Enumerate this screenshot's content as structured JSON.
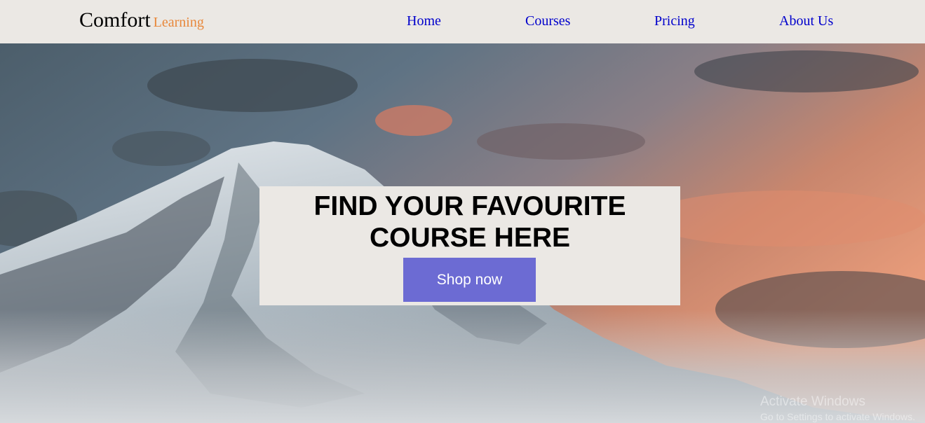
{
  "brand": {
    "main": "Comfort",
    "sub": "Learning"
  },
  "nav": {
    "items": [
      {
        "label": "Home"
      },
      {
        "label": "Courses"
      },
      {
        "label": "Pricing"
      },
      {
        "label": "About Us"
      }
    ]
  },
  "hero": {
    "title_line1": "FIND YOUR FAVOURITE",
    "title_line2": "COURSE HERE",
    "button_label": "Shop now",
    "image_icon": "mountain-sunset-image"
  },
  "watermark": {
    "title": "Activate Windows",
    "subtitle": "Go to Settings to activate Windows."
  },
  "colors": {
    "nav_background": "#ebe8e4",
    "brand_accent": "#e8873a",
    "link": "#0000cc",
    "button": "#6c6bd3"
  }
}
